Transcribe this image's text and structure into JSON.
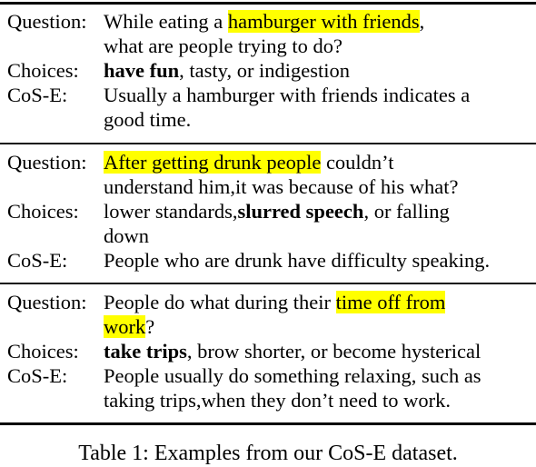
{
  "table": {
    "labels": {
      "question": "Question:",
      "choices": "Choices:",
      "cose": "CoS-E:"
    },
    "highlight_color": "#ffff00",
    "examples": [
      {
        "question": {
          "before": "While eating a ",
          "highlight": "hamburger with friends",
          "after": ",",
          "line2": "what are people trying to do?"
        },
        "choices": {
          "bold": "have fun",
          "rest": ", tasty, or indigestion"
        },
        "cose": {
          "line1": "Usually a hamburger with friends indicates a",
          "line2": "good time."
        }
      },
      {
        "question": {
          "highlight": "After getting drunk people",
          "after": " couldn’t",
          "line2": "understand him,it was because of his what?"
        },
        "choices": {
          "before": "lower standards,",
          "bold": "slurred speech",
          "rest": ", or falling",
          "line2": "down"
        },
        "cose": {
          "line1": "People who are drunk have difficulty speaking."
        }
      },
      {
        "question": {
          "before": "People do what during their ",
          "highlight": "time off from",
          "highlight2": "work",
          "after": "?"
        },
        "choices": {
          "bold": "take trips",
          "rest": ", brow shorter, or become hysterical"
        },
        "cose": {
          "line1": "People usually do something relaxing, such as",
          "line2": "taking trips,when they don’t need to work."
        }
      }
    ]
  },
  "caption": "Table 1: Examples from our CoS-E dataset."
}
